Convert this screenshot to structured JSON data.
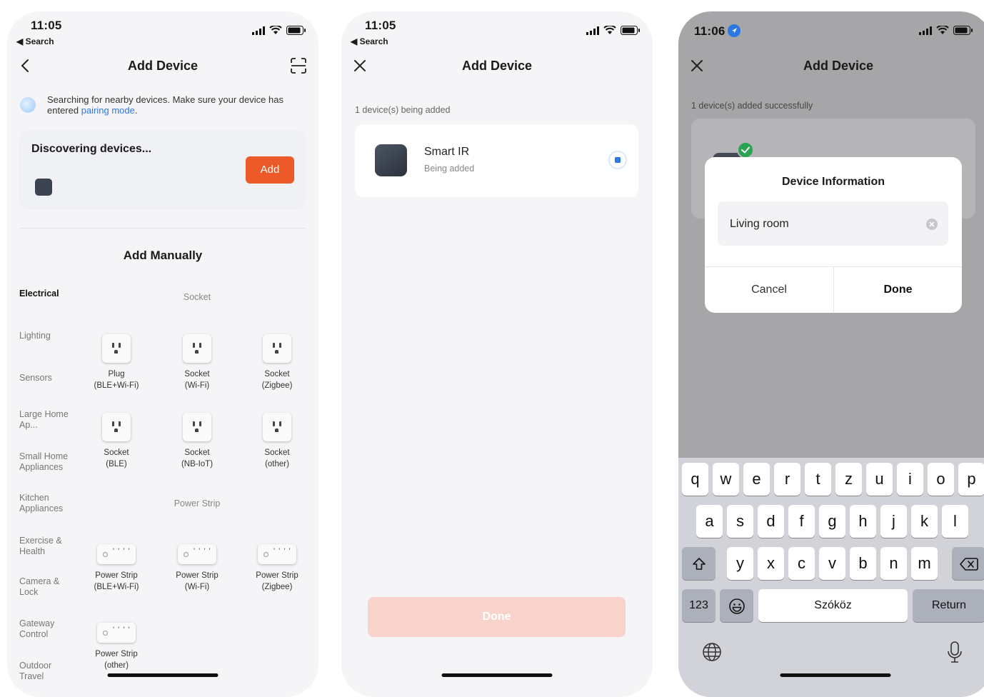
{
  "screen1": {
    "status": {
      "time": "11:05",
      "back_label": "◀ Search"
    },
    "nav": {
      "title": "Add Device"
    },
    "search_notice": {
      "text": "Searching for nearby devices. Make sure your device has entered ",
      "link": "pairing mode",
      "suffix": "."
    },
    "discover": {
      "title": "Discovering devices...",
      "add_label": "Add"
    },
    "manual_title": "Add Manually",
    "categories": [
      "Electrical",
      "Lighting",
      "Sensors",
      "Large Home Ap...",
      "Small Home Appliances",
      "Kitchen Appliances",
      "Exercise & Health",
      "Camera & Lock",
      "Gateway Control",
      "Outdoor Travel"
    ],
    "sections": {
      "socket": "Socket",
      "power_strip": "Power Strip"
    },
    "socket_tiles": [
      {
        "line1": "Plug",
        "line2": "(BLE+Wi-Fi)"
      },
      {
        "line1": "Socket",
        "line2": "(Wi-Fi)"
      },
      {
        "line1": "Socket",
        "line2": "(Zigbee)"
      },
      {
        "line1": "Socket",
        "line2": "(BLE)"
      },
      {
        "line1": "Socket",
        "line2": "(NB-IoT)"
      },
      {
        "line1": "Socket",
        "line2": "(other)"
      }
    ],
    "strip_tiles": [
      {
        "line1": "Power Strip",
        "line2": "(BLE+Wi-Fi)"
      },
      {
        "line1": "Power Strip",
        "line2": "(Wi-Fi)"
      },
      {
        "line1": "Power Strip",
        "line2": "(Zigbee)"
      },
      {
        "line1": "Power Strip",
        "line2": "(other)"
      }
    ]
  },
  "screen2": {
    "status": {
      "time": "11:05",
      "back_label": "◀ Search"
    },
    "nav": {
      "title": "Add Device"
    },
    "progress_label": "1 device(s) being added",
    "device": {
      "name": "Smart IR",
      "status": "Being added"
    },
    "done_label": "Done"
  },
  "screen3": {
    "status": {
      "time": "11:06"
    },
    "nav": {
      "title": "Add Device"
    },
    "success_label": "1 device(s) added successfully",
    "modal": {
      "title": "Device Information",
      "input_value": "Living room",
      "cancel_label": "Cancel",
      "done_label": "Done"
    },
    "keyboard": {
      "row1": [
        "q",
        "w",
        "e",
        "r",
        "t",
        "z",
        "u",
        "i",
        "o",
        "p"
      ],
      "row2": [
        "a",
        "s",
        "d",
        "f",
        "g",
        "h",
        "j",
        "k",
        "l"
      ],
      "row3": [
        "y",
        "x",
        "c",
        "v",
        "b",
        "n",
        "m"
      ],
      "numbers_label": "123",
      "space_label": "Szóköz",
      "return_label": "Return"
    }
  },
  "colors": {
    "accent_orange": "#ec5a2a",
    "link_blue": "#2b78e4",
    "success_green": "#2aa352"
  }
}
